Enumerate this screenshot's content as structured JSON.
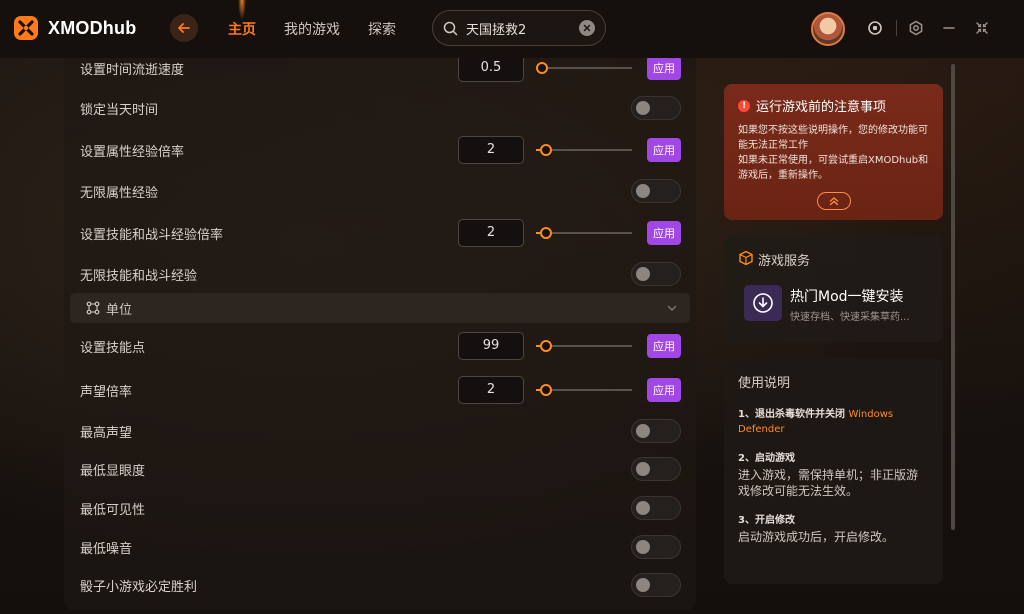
{
  "app": {
    "name": "XMODhub"
  },
  "nav": {
    "items": [
      {
        "label": "主页",
        "active": true
      },
      {
        "label": "我的游戏",
        "active": false
      },
      {
        "label": "探索",
        "active": false
      }
    ]
  },
  "search": {
    "value": "天国拯救2"
  },
  "rows": [
    {
      "label": "设置时间流逝速度",
      "type": "number",
      "value": "0.5",
      "slider": 0.0,
      "apply": "应用"
    },
    {
      "label": "锁定当天时间",
      "type": "toggle",
      "on": false
    },
    {
      "label": "设置属性经验倍率",
      "type": "number",
      "value": "2",
      "slider": 0.05,
      "apply": "应用"
    },
    {
      "label": "无限属性经验",
      "type": "toggle",
      "on": false
    },
    {
      "label": "设置技能和战斗经验倍率",
      "type": "number",
      "value": "2",
      "slider": 0.05,
      "apply": "应用"
    },
    {
      "label": "无限技能和战斗经验",
      "type": "toggle",
      "on": false
    }
  ],
  "section": {
    "title": "单位"
  },
  "unit_rows": [
    {
      "label": "设置技能点",
      "type": "number",
      "value": "99",
      "slider": 0.05,
      "apply": "应用"
    },
    {
      "label": "声望倍率",
      "type": "number",
      "value": "2",
      "slider": 0.05,
      "apply": "应用"
    },
    {
      "label": "最高声望",
      "type": "toggle",
      "on": false
    },
    {
      "label": "最低显眼度",
      "type": "toggle",
      "on": false
    },
    {
      "label": "最低可见性",
      "type": "toggle",
      "on": false
    },
    {
      "label": "最低噪音",
      "type": "toggle",
      "on": false
    },
    {
      "label": "骰子小游戏必定胜利",
      "type": "toggle",
      "on": false
    }
  ],
  "notice": {
    "title": "运行游戏前的注意事项",
    "body_line1": "如果您不按这些说明操作，您的修改功能可能无法正常工作",
    "body_line2": "如果未正常使用，可尝试重启XMODhub和游戏后，重新操作。"
  },
  "service": {
    "title": "游戏服务",
    "item_name": "热门Mod一键安装",
    "item_desc": "快速存档、快速采集草药..."
  },
  "usage": {
    "title": "使用说明",
    "step1_title": "1、退出杀毒软件并关闭",
    "step1_highlight": "Windows Defender",
    "step2_title": "2、启动游戏",
    "step2_body": "进入游戏，需保持单机；非正版游戏修改可能无法生效。",
    "step3_title": "3、开启修改",
    "step3_body": "启动游戏成功后，开启修改。"
  },
  "colors": {
    "accent": "#ff8c1a",
    "apply": "#a047e6",
    "notice_bg": "#7a2a1a"
  }
}
